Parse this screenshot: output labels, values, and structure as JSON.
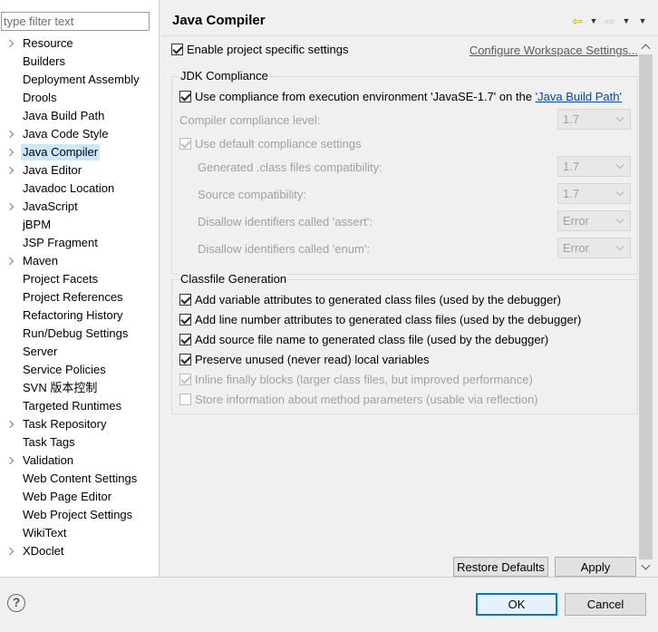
{
  "filter": {
    "placeholder": "type filter text"
  },
  "tree": {
    "items": [
      {
        "label": "Resource",
        "expandable": true
      },
      {
        "label": "Builders",
        "expandable": false
      },
      {
        "label": "Deployment Assembly",
        "expandable": false
      },
      {
        "label": "Drools",
        "expandable": false
      },
      {
        "label": "Java Build Path",
        "expandable": false
      },
      {
        "label": "Java Code Style",
        "expandable": true
      },
      {
        "label": "Java Compiler",
        "expandable": true,
        "selected": true
      },
      {
        "label": "Java Editor",
        "expandable": true
      },
      {
        "label": "Javadoc Location",
        "expandable": false
      },
      {
        "label": "JavaScript",
        "expandable": true
      },
      {
        "label": "jBPM",
        "expandable": false
      },
      {
        "label": "JSP Fragment",
        "expandable": false
      },
      {
        "label": "Maven",
        "expandable": true
      },
      {
        "label": "Project Facets",
        "expandable": false
      },
      {
        "label": "Project References",
        "expandable": false
      },
      {
        "label": "Refactoring History",
        "expandable": false
      },
      {
        "label": "Run/Debug Settings",
        "expandable": false
      },
      {
        "label": "Server",
        "expandable": false
      },
      {
        "label": "Service Policies",
        "expandable": false
      },
      {
        "label": "SVN 版本控制",
        "expandable": false
      },
      {
        "label": "Targeted Runtimes",
        "expandable": false
      },
      {
        "label": "Task Repository",
        "expandable": true
      },
      {
        "label": "Task Tags",
        "expandable": false
      },
      {
        "label": "Validation",
        "expandable": true
      },
      {
        "label": "Web Content Settings",
        "expandable": false
      },
      {
        "label": "Web Page Editor",
        "expandable": false
      },
      {
        "label": "Web Project Settings",
        "expandable": false
      },
      {
        "label": "WikiText",
        "expandable": false
      },
      {
        "label": "XDoclet",
        "expandable": true
      }
    ]
  },
  "page": {
    "title": "Java Compiler",
    "enable_label": "Enable project specific settings",
    "configure_link": "Configure Workspace Settings...",
    "jdk": {
      "title": "JDK Compliance",
      "use_env_prefix": "Use compliance from execution environment 'JavaSE-1.7' on the ",
      "use_env_link": "'Java Build Path'",
      "compliance_label": "Compiler compliance level:",
      "compliance_value": "1.7",
      "default_label": "Use default compliance settings",
      "generated_label": "Generated .class files compatibility:",
      "generated_value": "1.7",
      "source_label": "Source compatibility:",
      "source_value": "1.7",
      "assert_label": "Disallow identifiers called 'assert':",
      "assert_value": "Error",
      "enum_label": "Disallow identifiers called 'enum':",
      "enum_value": "Error"
    },
    "classfile": {
      "title": "Classfile Generation",
      "var_attr": "Add variable attributes to generated class files (used by the debugger)",
      "line_num": "Add line number attributes to generated class files (used by the debugger)",
      "source_name": "Add source file name to generated class file (used by the debugger)",
      "preserve": "Preserve unused (never read) local variables",
      "inline": "Inline finally blocks (larger class files, but improved performance)",
      "store_params": "Store information about method parameters (usable via reflection)"
    },
    "restore_label": "Restore Defaults",
    "apply_label": "Apply"
  },
  "dialog": {
    "ok_label": "OK",
    "cancel_label": "Cancel",
    "help_glyph": "?"
  }
}
